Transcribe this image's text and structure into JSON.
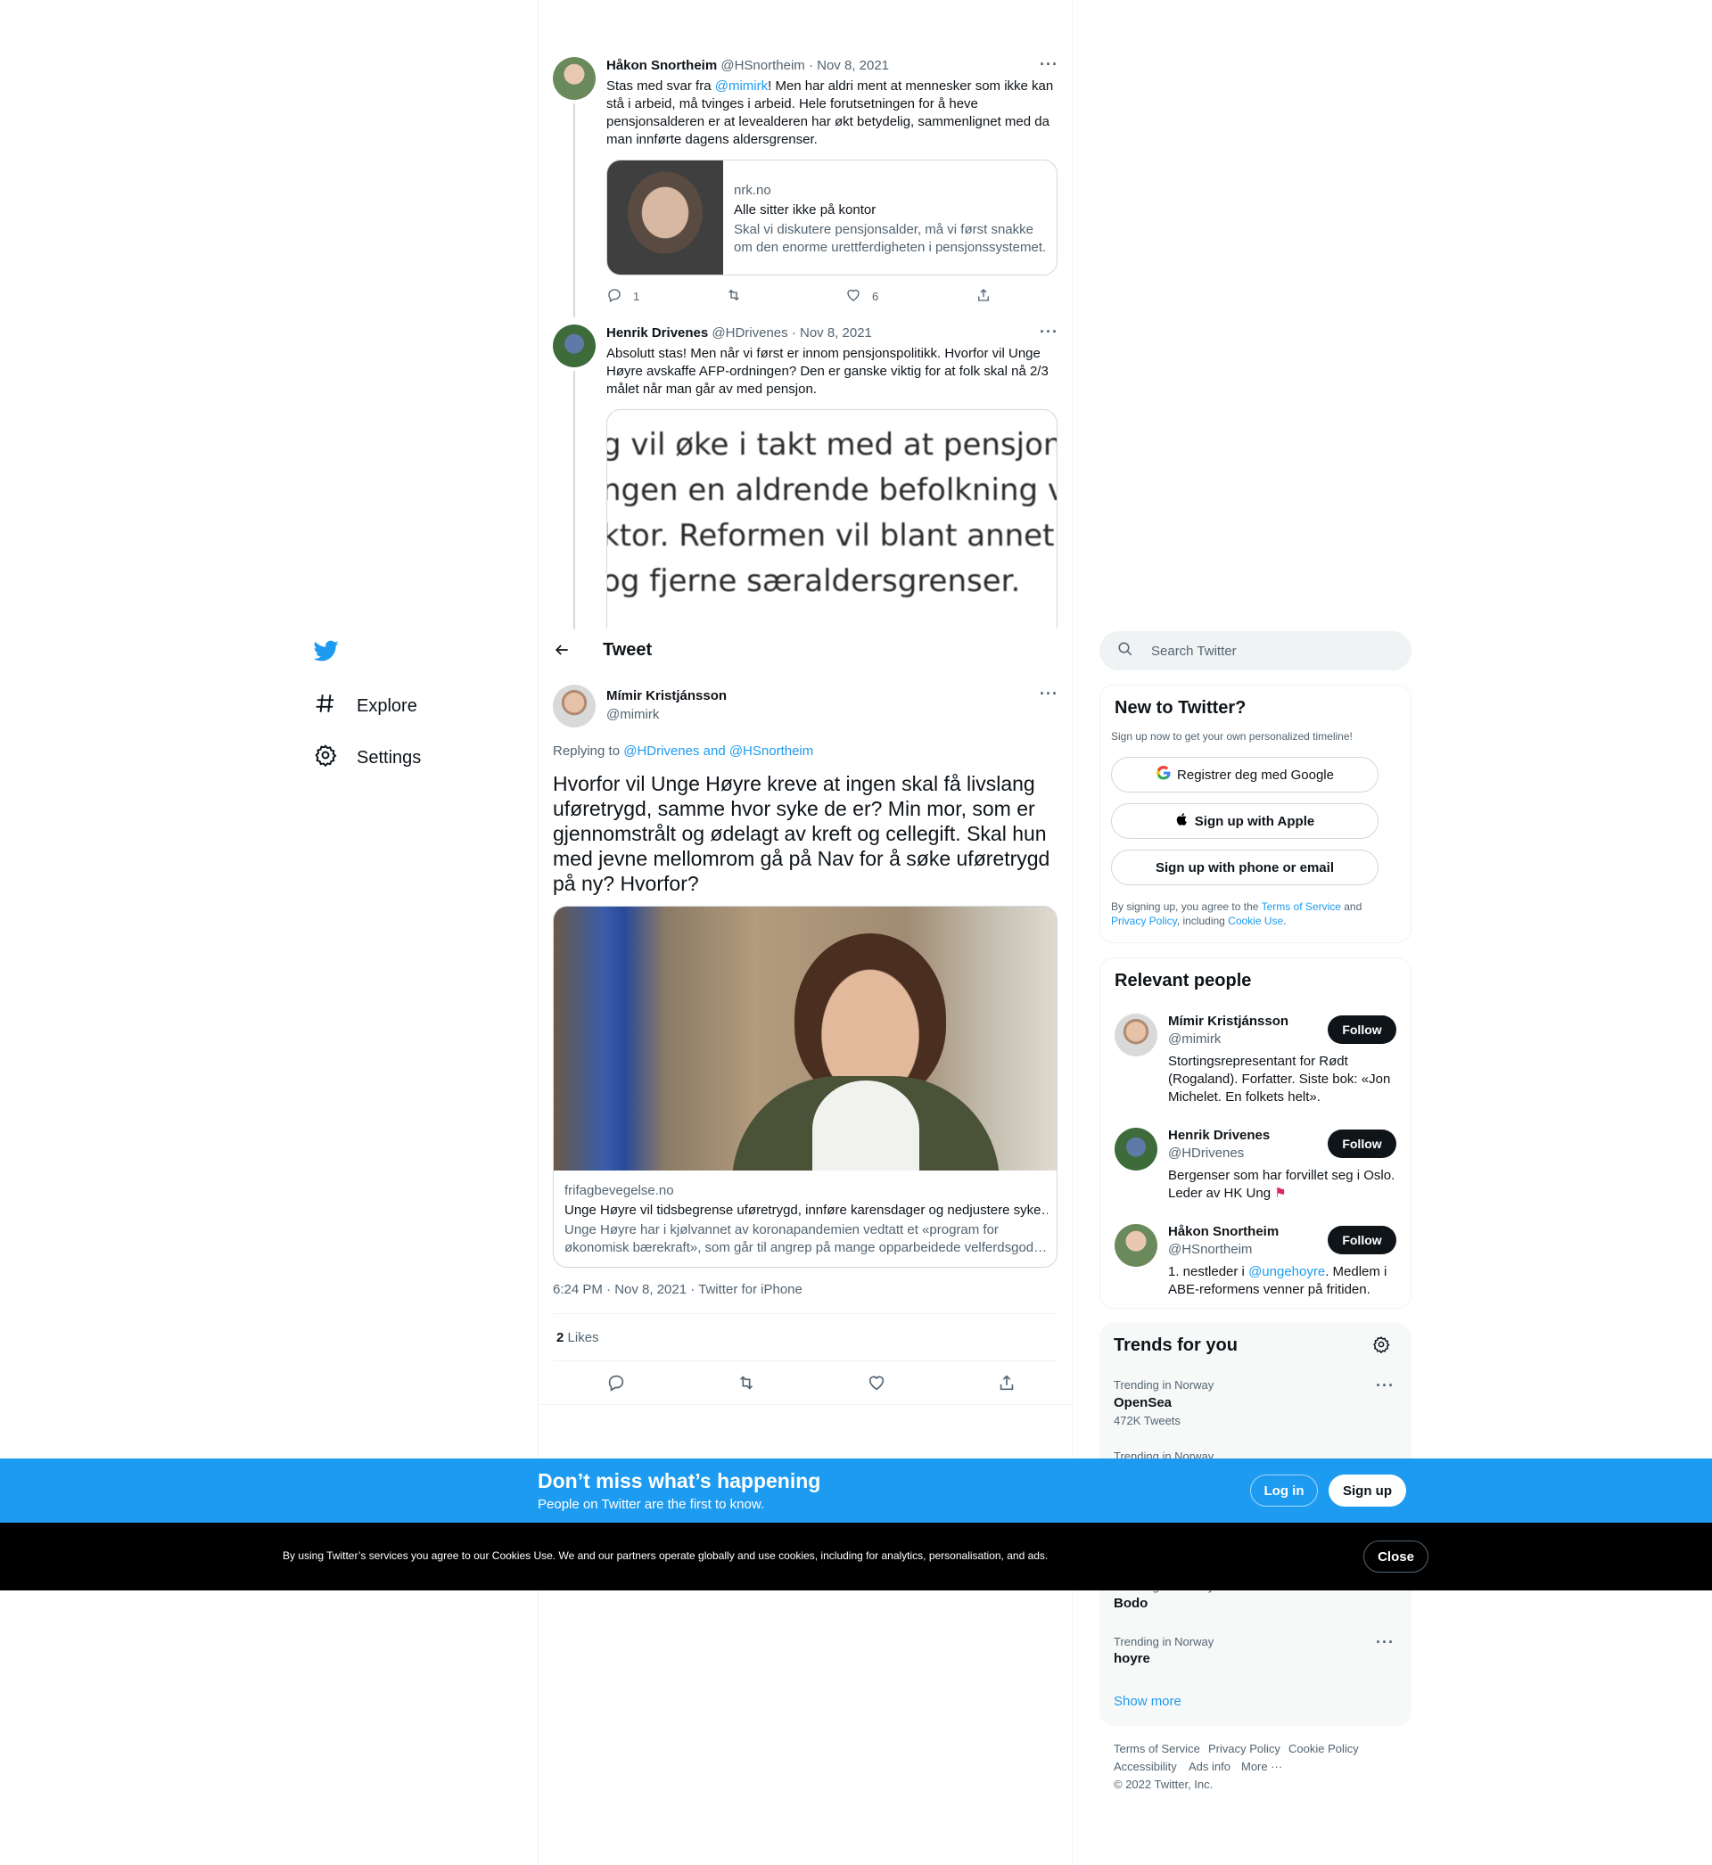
{
  "nav": {
    "explore": "Explore",
    "settings": "Settings"
  },
  "tweets": [
    {
      "name": "Håkon Snortheim",
      "handle": "@HSnortheim",
      "date": "· Nov 8, 2021",
      "text_before": "Stas med svar fra ",
      "mention": "@mimirk",
      "text_after": "! Men har aldri ment at mennesker som ikke kan stå i arbeid, må tvinges i arbeid. Hele forutsetningen for å heve pensjonsalderen er at levealderen har økt betydelig, sammenlignet med da man innførte dagens aldersgrenser.",
      "card": {
        "domain": "nrk.no",
        "title": "Alle sitter ikke på kontor",
        "desc": "Skal vi diskutere pensjonsalder, må vi først snakke om den enorme urettferdigheten i pensjonssystemet."
      },
      "replies": "1",
      "likes": "6"
    },
    {
      "name": "Henrik Drivenes",
      "handle": "@HDrivenes",
      "date": "· Nov 8, 2021",
      "text": "Absolutt stas! Men når vi først er innom pensjonspolitikk. Hvorfor vil Unge Høyre avskaffe AFP-ordningen? Den er ganske viktig for at folk skal nå 2/3 målet når man går av med pensjon.",
      "image_lines": [
        "g vil øke i takt med at pensjonis",
        "ngen en aldrende befolkning v",
        "ktor. Reformen vil blant annet i",
        "og fjerne særaldersgrenser."
      ]
    }
  ],
  "header": {
    "title": "Tweet"
  },
  "main_tweet": {
    "name": "Mímir Kristjánsson",
    "handle": "@mimirk",
    "replying_label": "Replying to ",
    "replying_to": "@HDrivenes and @HSnortheim",
    "text": "Hvorfor vil Unge Høyre kreve at ingen skal få livslang uføretrygd, samme hvor syke de er? Min mor, som er gjennomstrålt og ødelagt av kreft og cellegift. Skal hun med jevne mellomrom gå på Nav for å søke uføretrygd på ny? Hvorfor?",
    "card": {
      "domain": "frifagbevegelse.no",
      "title": "Unge Høyre vil tidsbegrense uføretrygd, innføre karensdager og nedjustere syke…",
      "desc": "Unge Høyre har i kjølvannet av koronapandemien vedtatt et «program for økonomisk bærekraft», som går til angrep på mange opparbeidede velferdsgod…"
    },
    "meta": "6:24 PM · Nov 8, 2021 · Twitter for iPhone",
    "likes_count": "2",
    "likes_label": "Likes"
  },
  "search": {
    "placeholder": "Search Twitter"
  },
  "signup": {
    "title": "New to Twitter?",
    "subtitle": "Sign up now to get your own personalized timeline!",
    "google": "Registrer deg med Google",
    "apple": "Sign up with Apple",
    "phone": "Sign up with phone or email",
    "legal_1": "By signing up, you agree to the ",
    "tos": "Terms of Service",
    "legal_2": " and ",
    "privacy": "Privacy Policy",
    "legal_3": ", including ",
    "cookie": "Cookie Use",
    "legal_4": "."
  },
  "relevant": {
    "title": "Relevant people",
    "follow_label": "Follow",
    "people": [
      {
        "name": "Mímir Kristjánsson",
        "handle": "@mimirk",
        "bio": "Stortingsrepresentant for Rødt (Rogaland). Forfatter. Siste bok: «Jon Michelet. En folkets helt»."
      },
      {
        "name": "Henrik Drivenes",
        "handle": "@HDrivenes",
        "bio": "Bergenser som har forvillet seg i Oslo. Leder av HK Ung"
      },
      {
        "name": "Håkon Snortheim",
        "handle": "@HSnortheim",
        "bio_1": "1. nestleder i ",
        "bio_mention": "@ungehoyre",
        "bio_2": ". Medlem i ABE-reformens venner på fritiden."
      }
    ]
  },
  "trends": {
    "title": "Trends for you",
    "items": [
      {
        "context": "Trending in Norway",
        "name": "OpenSea",
        "count": "472K Tweets"
      },
      {
        "context": "Trending in Norway",
        "name": "",
        "count": ""
      },
      {
        "context": "Trending in Norway",
        "name": "Bodo",
        "count": ""
      },
      {
        "context": "Trending in Norway",
        "name": "hoyre",
        "count": ""
      }
    ],
    "show_more": "Show more"
  },
  "footer": {
    "tos": "Terms of Service",
    "privacy": "Privacy Policy",
    "cookie": "Cookie Policy",
    "accessibility": "Accessibility",
    "ads": "Ads info",
    "more": "More ···",
    "copyright": "© 2022 Twitter, Inc."
  },
  "banner": {
    "title": "Don’t miss what’s happening",
    "subtitle": "People on Twitter are the first to know.",
    "login": "Log in",
    "signup": "Sign up"
  },
  "cookie_bar": {
    "text": "By using Twitter’s services you agree to our Cookies Use. We and our partners operate globally and use cookies, including for analytics, personalisation, and ads.",
    "close": "Close"
  },
  "colors": {
    "accent": "#1d9bf0",
    "text": "#0f1419",
    "muted": "#536471",
    "border": "#cfd9de"
  }
}
